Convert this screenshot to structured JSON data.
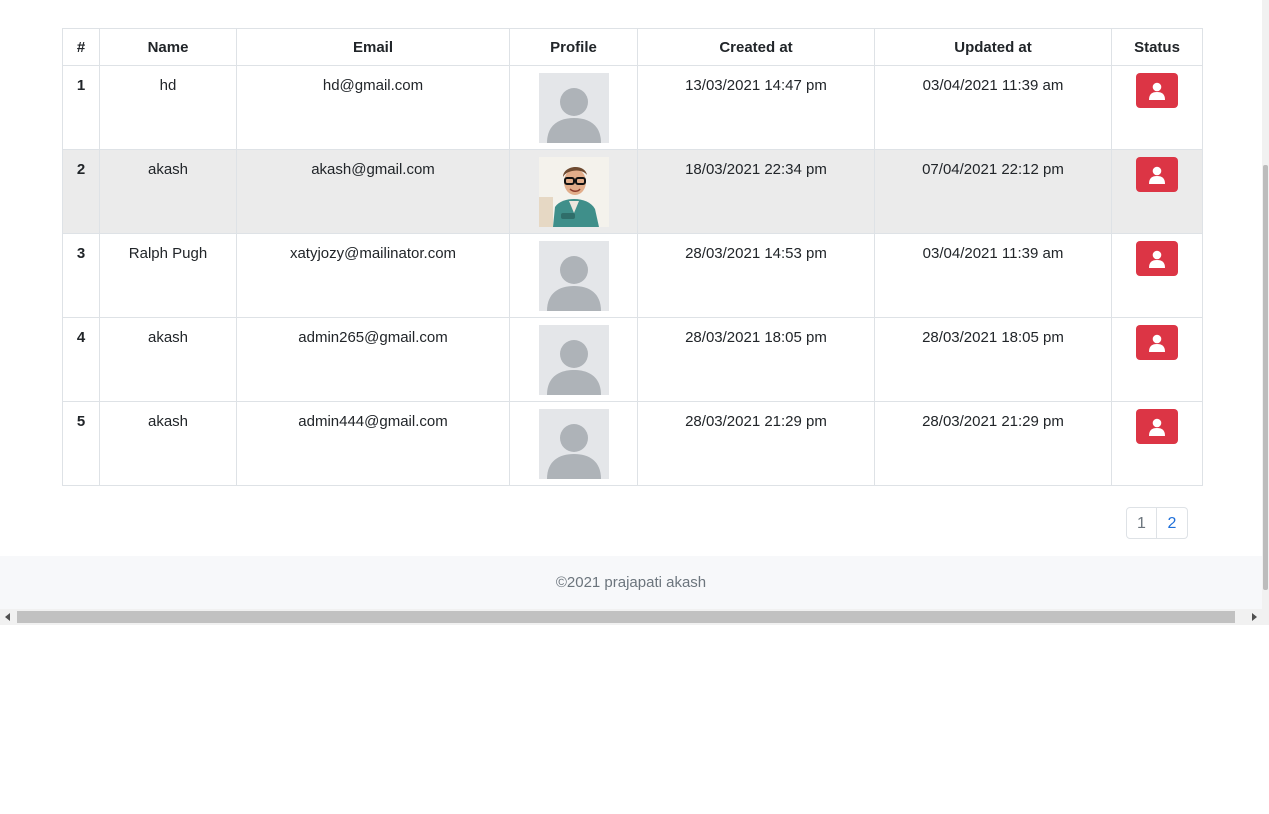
{
  "table": {
    "headers": [
      "#",
      "Name",
      "Email",
      "Profile",
      "Created at",
      "Updated at",
      "Status"
    ],
    "rows": [
      {
        "num": "1",
        "name": "hd",
        "email": "hd@gmail.com",
        "profile": "default-avatar",
        "created": "13/03/2021 14:47 pm",
        "updated": "03/04/2021 11:39 am",
        "status_icon": "user-icon"
      },
      {
        "num": "2",
        "name": "akash",
        "email": "akash@gmail.com",
        "profile": "photo",
        "created": "18/03/2021 22:34 pm",
        "updated": "07/04/2021 22:12 pm",
        "status_icon": "user-icon"
      },
      {
        "num": "3",
        "name": "Ralph Pugh",
        "email": "xatyjozy@mailinator.com",
        "profile": "default-avatar",
        "created": "28/03/2021 14:53 pm",
        "updated": "03/04/2021 11:39 am",
        "status_icon": "user-icon"
      },
      {
        "num": "4",
        "name": "akash",
        "email": "admin265@gmail.com",
        "profile": "default-avatar",
        "created": "28/03/2021 18:05 pm",
        "updated": "28/03/2021 18:05 pm",
        "status_icon": "user-icon"
      },
      {
        "num": "5",
        "name": "akash",
        "email": "admin444@gmail.com",
        "profile": "default-avatar",
        "created": "28/03/2021 21:29 pm",
        "updated": "28/03/2021 21:29 pm",
        "status_icon": "user-icon"
      }
    ]
  },
  "pagination": {
    "pages": [
      "1",
      "2"
    ],
    "current": "1"
  },
  "footer": {
    "text": "©2021 prajapati akash"
  },
  "colors": {
    "status_button": "#dc3545",
    "row_highlight": "#ebebeb",
    "link": "#1e6fd9",
    "footer_bg": "#f7f8fa"
  }
}
